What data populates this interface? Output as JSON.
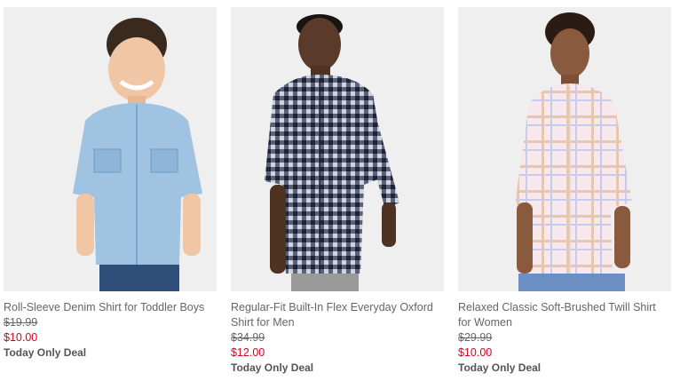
{
  "colors": {
    "sale_price": "#d0021b",
    "text": "#666666",
    "photo_bg": "#efefef"
  },
  "products": [
    {
      "image_icon": "toddler-denim-shirt-photo",
      "title": "Roll-Sleeve Denim Shirt for Toddler Boys",
      "original_price": "$19.99",
      "sale_price": "$10.00",
      "deal_label": "Today Only Deal"
    },
    {
      "image_icon": "men-gingham-shirt-photo",
      "title": "Regular-Fit Built-In Flex Everyday Oxford Shirt for Men",
      "original_price": "$34.99",
      "sale_price": "$12.00",
      "deal_label": "Today Only Deal"
    },
    {
      "image_icon": "women-plaid-shirt-photo",
      "title": "Relaxed Classic Soft-Brushed Twill Shirt for Women",
      "original_price": "$29.99",
      "sale_price": "$10.00",
      "deal_label": "Today Only Deal"
    }
  ]
}
